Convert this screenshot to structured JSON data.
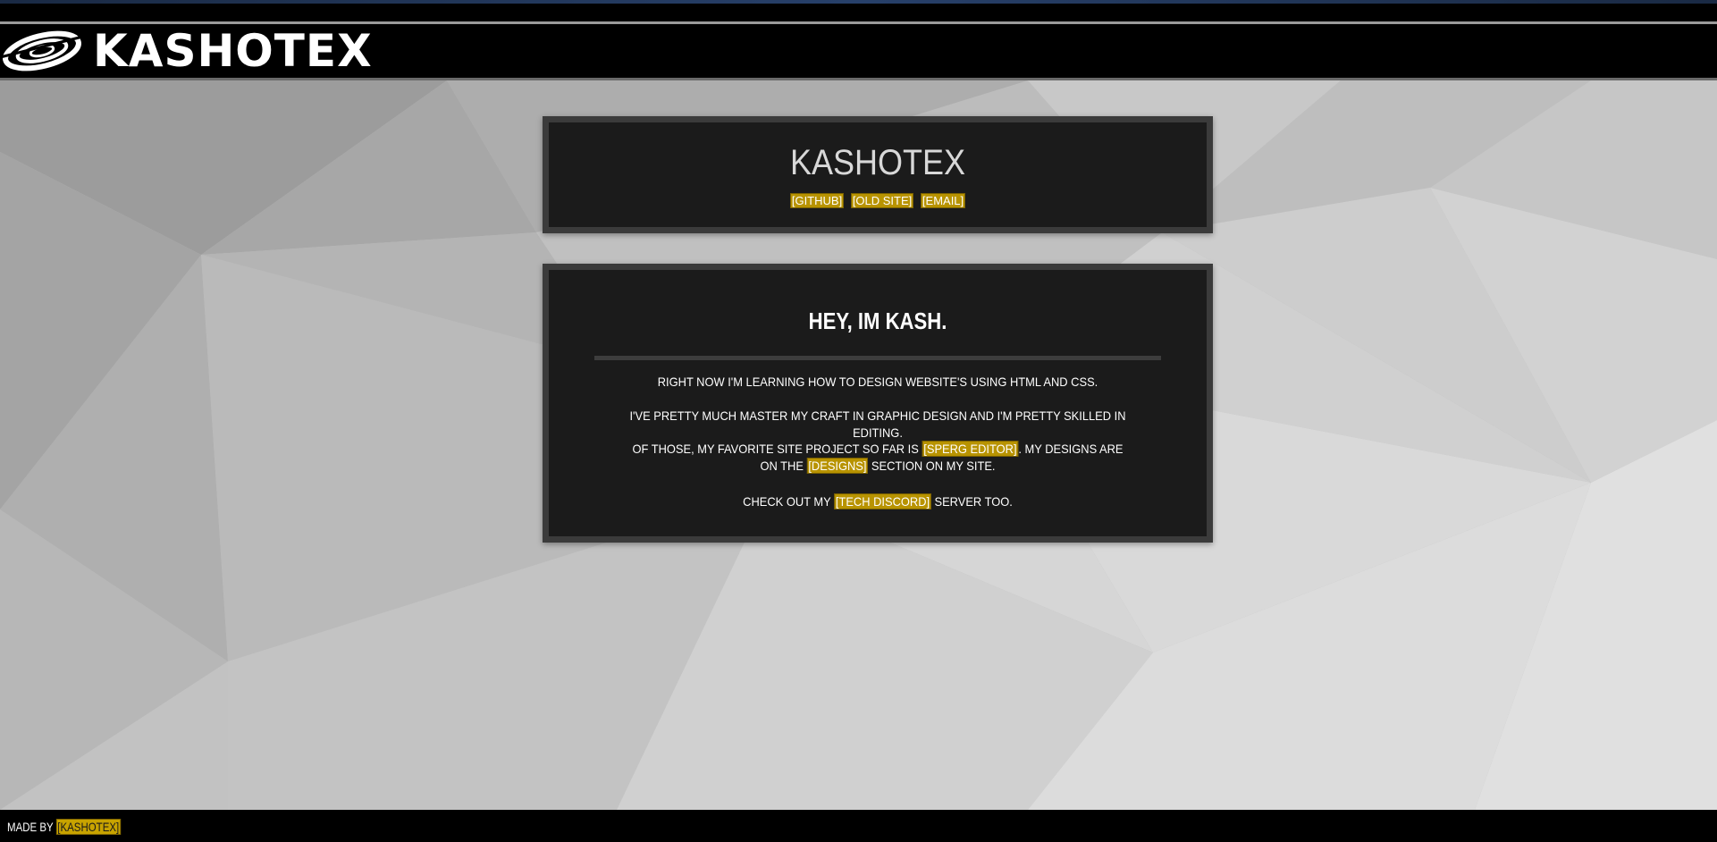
{
  "header": {
    "brand_name": "KASHOTEX",
    "logo_icon": "spiral-orbit-logo"
  },
  "intro_panel": {
    "title": "KASHOTEX",
    "links": [
      {
        "label": "[GITHUB]"
      },
      {
        "label": "[OLD SITE]"
      },
      {
        "label": "[EMAIL]"
      }
    ]
  },
  "about_panel": {
    "heading": "HEY, IM KASH.",
    "p1": "RIGHT NOW I'M LEARNING HOW TO DESIGN WEBSITE'S USING HTML AND CSS.",
    "p2": "I'VE PRETTY MUCH MASTER MY CRAFT IN GRAPHIC DESIGN AND I'M PRETTY SKILLED IN EDITING.",
    "p3_before": "OF THOSE, MY FAVORITE SITE PROJECT SO FAR IS",
    "p3_link1": "[SPERG EDITOR]",
    "p3_middle": ". MY DESIGNS ARE ON THE",
    "p3_link2": "[DESIGNS]",
    "p3_after": "SECTION ON MY SITE.",
    "p4_before": "CHECK OUT MY",
    "p4_link": "[TECH DISCORD]",
    "p4_after": "SERVER TOO."
  },
  "footer": {
    "made_by": "MADE BY",
    "link": "[KASHOTEX]"
  },
  "colors": {
    "highlight": "#c8a300",
    "panel_bg": "#1b1b1b",
    "panel_border": "#3b3b3b",
    "bar_bg": "#000000"
  }
}
